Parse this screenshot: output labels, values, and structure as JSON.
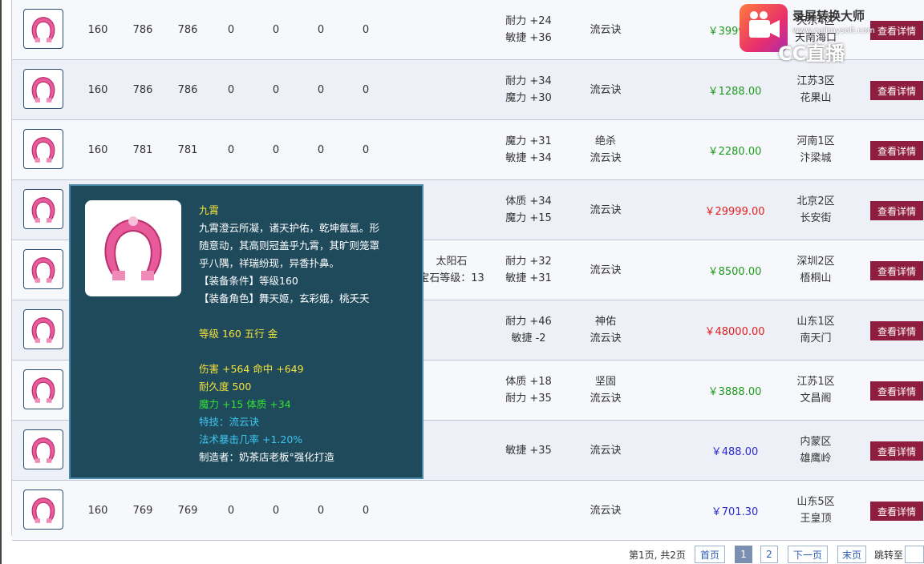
{
  "rows": [
    {
      "level": "160",
      "a": "786",
      "b": "786",
      "c": "0",
      "d": "0",
      "e": "0",
      "f": "0",
      "stat1": "耐力 +24",
      "stat2": "敏捷 +36",
      "skill1": "流云诀",
      "skill2": "",
      "price": "￥3999.00",
      "price_color": "green",
      "server1": "天东4区",
      "server2": "天南海口"
    },
    {
      "level": "160",
      "a": "786",
      "b": "786",
      "c": "0",
      "d": "0",
      "e": "0",
      "f": "0",
      "stat1": "耐力 +34",
      "stat2": "魔力 +30",
      "skill1": "流云诀",
      "skill2": "",
      "price": "￥1288.00",
      "price_color": "green",
      "server1": "江苏3区",
      "server2": "花果山"
    },
    {
      "level": "160",
      "a": "781",
      "b": "781",
      "c": "0",
      "d": "0",
      "e": "0",
      "f": "0",
      "stat1": "魔力 +31",
      "stat2": "敏捷 +34",
      "skill1": "绝杀",
      "skill2": "流云诀",
      "price": "￥2280.00",
      "price_color": "green",
      "server1": "河南1区",
      "server2": "汴梁城"
    },
    {
      "level": "",
      "a": "",
      "b": "",
      "c": "",
      "d": "",
      "e": "",
      "f": "",
      "stat1": "体质 +34",
      "stat2": "魔力 +15",
      "skill1": "流云诀",
      "skill2": "",
      "price": "￥29999.00",
      "price_color": "red",
      "server1": "北京2区",
      "server2": "长安街"
    },
    {
      "level": "",
      "a": "",
      "b": "",
      "c": "",
      "d": "",
      "e": "",
      "f": "",
      "gem1": "太阳石",
      "gem2": "宝石等级：13",
      "stat1": "耐力 +32",
      "stat2": "敏捷 +31",
      "skill1": "流云诀",
      "skill2": "",
      "price": "￥8500.00",
      "price_color": "green",
      "server1": "深圳2区",
      "server2": "梧桐山"
    },
    {
      "level": "",
      "a": "",
      "b": "",
      "c": "",
      "d": "",
      "e": "",
      "f": "",
      "stat1": "耐力 +46",
      "stat2": "敏捷 -2",
      "skill1": "神佑",
      "skill2": "流云诀",
      "price": "￥48000.00",
      "price_color": "red",
      "server1": "山东1区",
      "server2": "南天门"
    },
    {
      "level": "",
      "a": "",
      "b": "",
      "c": "",
      "d": "",
      "e": "",
      "f": "",
      "stat1": "体质 +18",
      "stat2": "耐力 +35",
      "skill1": "坚固",
      "skill2": "流云诀",
      "price": "￥3888.00",
      "price_color": "green",
      "server1": "江苏1区",
      "server2": "文昌阁"
    },
    {
      "level": "",
      "a": "",
      "b": "",
      "c": "",
      "d": "",
      "e": "",
      "f": "",
      "stat1": "敏捷 +35",
      "stat2": "",
      "skill1": "流云诀",
      "skill2": "",
      "price": "￥488.00",
      "price_color": "blue",
      "server1": "内蒙区",
      "server2": "雄鹰岭"
    },
    {
      "level": "160",
      "a": "769",
      "b": "769",
      "c": "0",
      "d": "0",
      "e": "0",
      "f": "0",
      "stat1": "",
      "stat2": "",
      "skill1": "流云诀",
      "skill2": "",
      "price": "￥701.30",
      "price_color": "blue",
      "server1": "山东5区",
      "server2": "王皇顶"
    }
  ],
  "detail_button": "查看详情",
  "tooltip": {
    "name": "九霄",
    "desc": [
      "九霄澄云所凝，诸天护佑，乾坤氤氲。形",
      "随意动，其高则冠盖乎九霄，其旷则笼罩",
      "乎八隅，祥瑞纷现，异香扑鼻。"
    ],
    "req_level": "【装备条件】等级160",
    "req_role": "【装备角色】舞天姬，玄彩娥，桃夭夭",
    "grade": "等级 160 五行 金",
    "attack": "伤害 +564 命中 +649",
    "durability": "耐久度 500",
    "bonus": "魔力 +15 体质 +34",
    "special_skill": "特技：流云诀",
    "crit": "法术暴击几率 +1.20%",
    "maker": "制造者：奶茶店老板°强化打造"
  },
  "pager": {
    "info": "第1页, 共2页",
    "first": "首页",
    "page1": "1",
    "page2": "2",
    "next": "下一页",
    "last": "末页",
    "jump": "跳转至"
  },
  "watermark": {
    "title": "录屏转换大师",
    "url": "www.callmysoft.com",
    "brand": "CC直播"
  }
}
